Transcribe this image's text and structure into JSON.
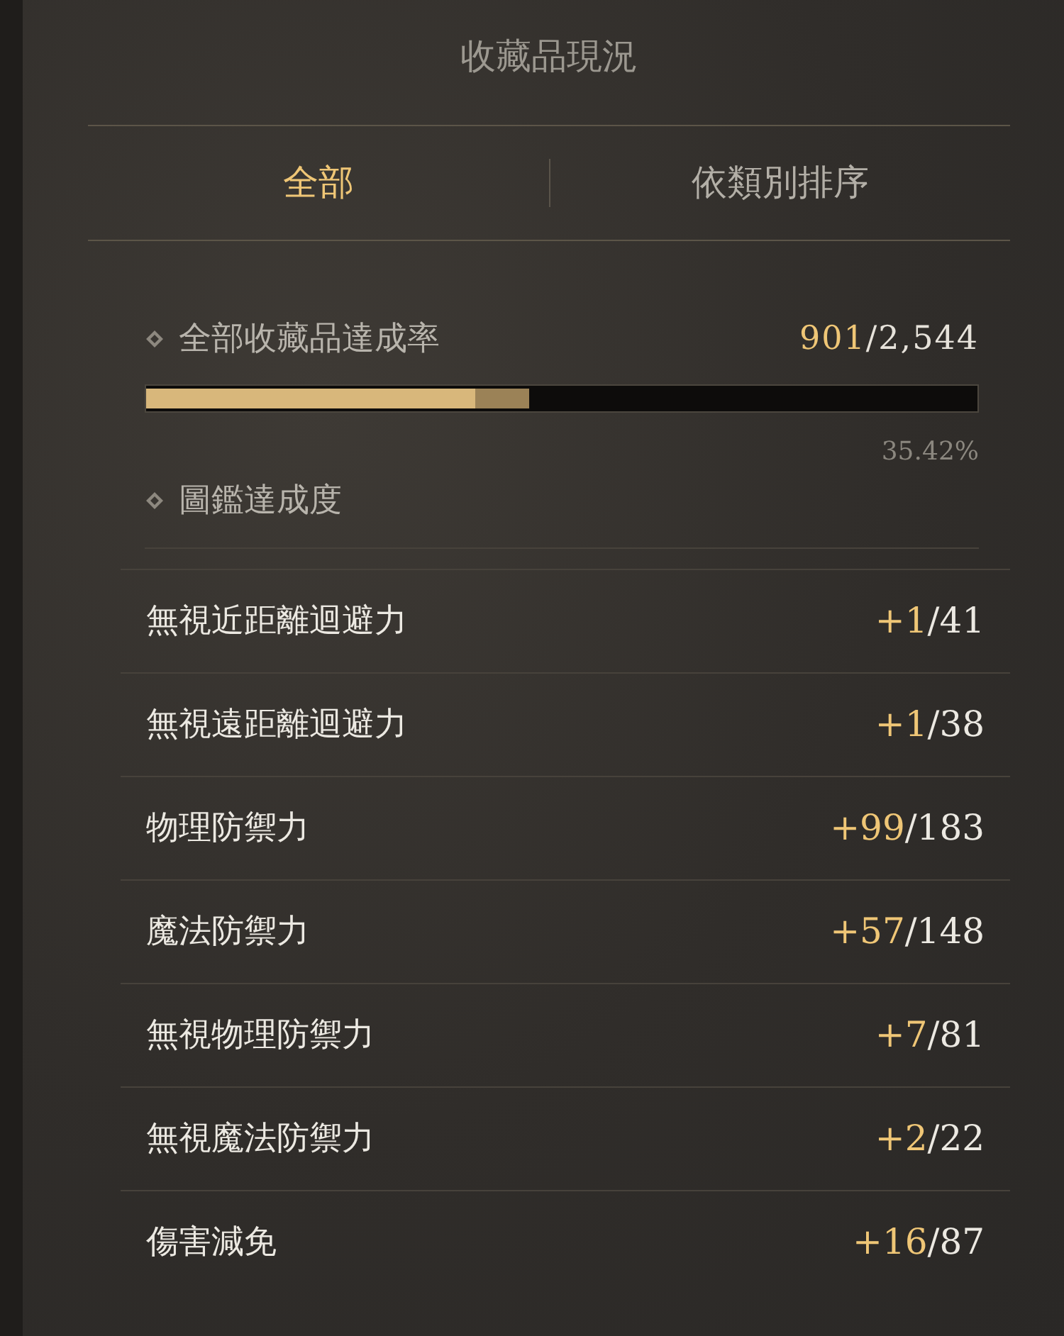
{
  "title": "收藏品現況",
  "tabs": [
    {
      "label": "全部",
      "selected": true
    },
    {
      "label": "依類別排序",
      "selected": false
    }
  ],
  "overall": {
    "label": "全部收藏品達成率",
    "current": "901",
    "total": "/2,544",
    "level": 0.46,
    "percent": "35.42%"
  },
  "codex": {
    "label": "圖鑑達成度"
  },
  "stats": [
    {
      "name": "無視近距離迴避力",
      "bonus": "+1",
      "cap": "/41"
    },
    {
      "name": "無視遠距離迴避力",
      "bonus": "+1",
      "cap": "/38"
    },
    {
      "name": "物理防禦力",
      "bonus": "+99",
      "cap": "/183"
    },
    {
      "name": "魔法防禦力",
      "bonus": "+57",
      "cap": "/148"
    },
    {
      "name": "無視物理防禦力",
      "bonus": "+7",
      "cap": "/81"
    },
    {
      "name": "無視魔法防禦力",
      "bonus": "+2",
      "cap": "/22"
    },
    {
      "name": "傷害減免",
      "bonus": "+16",
      "cap": "/87"
    }
  ]
}
